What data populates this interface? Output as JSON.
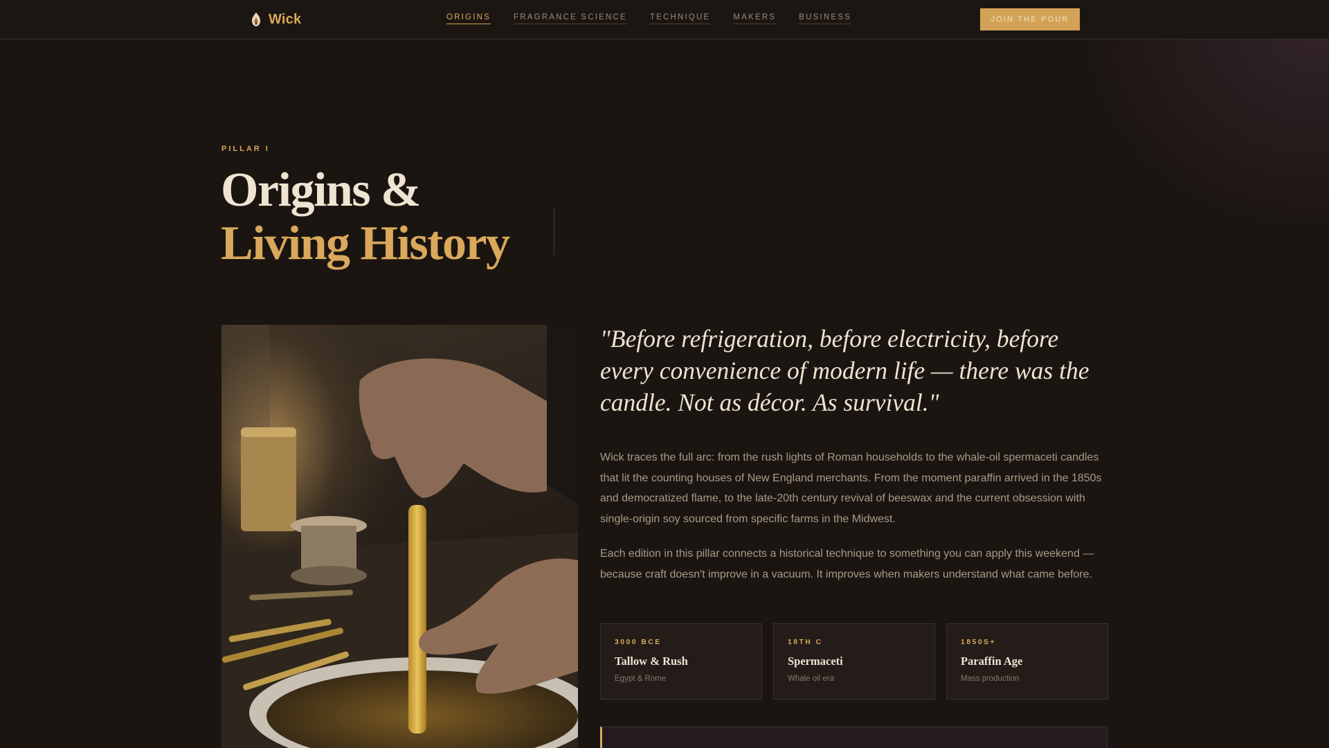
{
  "nav": {
    "brand": "Wick",
    "logo_icon": "candle-flame-icon",
    "links": [
      {
        "label": "ORIGINS",
        "active": true
      },
      {
        "label": "FRAGRANCE SCIENCE",
        "active": false
      },
      {
        "label": "TECHNIQUE",
        "active": false
      },
      {
        "label": "MAKERS",
        "active": false
      },
      {
        "label": "BUSINESS",
        "active": false
      }
    ],
    "cta": "JOIN THE POUR"
  },
  "hero": {
    "eyebrow": "PILLAR I",
    "title_line1": "Origins &",
    "title_line2": "Living History"
  },
  "content": {
    "image_subject": "hands dipping a beeswax taper candle into molten wax",
    "quote": "\"Before refrigeration, before electricity, before every convenience of modern life — there was the candle. Not as décor. As survival.\"",
    "paragraph_1": "Wick traces the full arc: from the rush lights of Roman households to the whale-oil spermaceti candles that lit the counting houses of New England merchants. From the moment paraffin arrived in the 1850s and democratized flame, to the late-20th century revival of beeswax and the current obsession with single-origin soy sourced from specific farms in the Midwest.",
    "paragraph_2": "Each edition in this pillar connects a historical technique to something you can apply this weekend — because craft doesn't improve in a vacuum. It improves when makers understand what came before."
  },
  "eras": [
    {
      "era": "3000 BCE",
      "title": "Tallow & Rush",
      "subtitle": "Egypt & Rome"
    },
    {
      "era": "18TH C",
      "title": "Spermaceti",
      "subtitle": "Whale oil era"
    },
    {
      "era": "1850S+",
      "title": "Paraffin Age",
      "subtitle": "Mass production"
    }
  ],
  "colors": {
    "background": "#1b1512",
    "accent_gold": "#d9a85b",
    "cream": "#efe4d1",
    "muted_text": "#a99a86"
  }
}
